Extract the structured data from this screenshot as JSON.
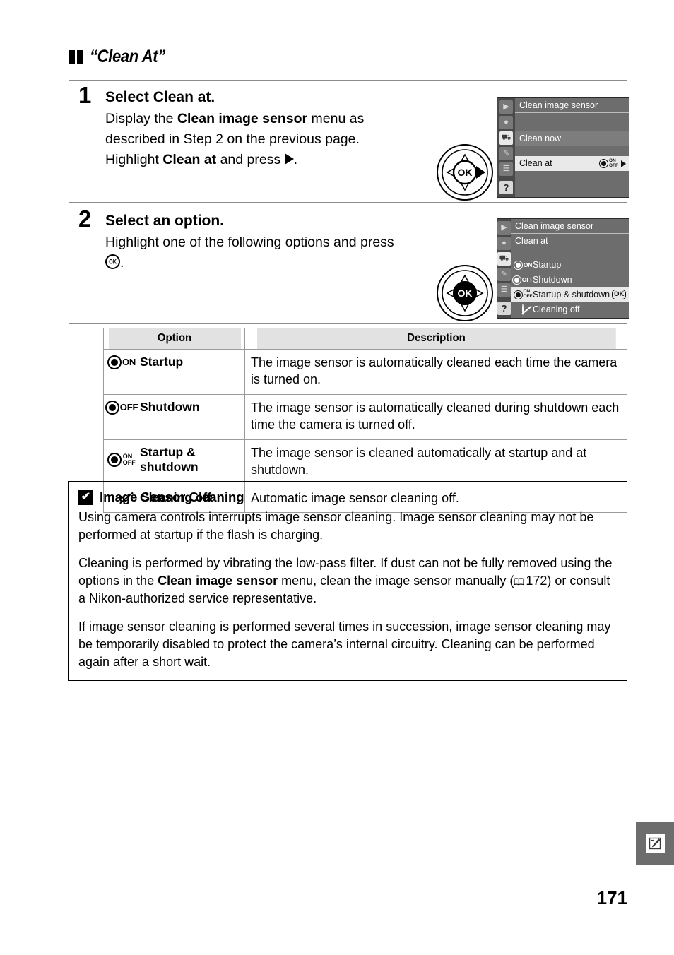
{
  "section": {
    "title": "“Clean At”"
  },
  "steps": [
    {
      "number": "1",
      "title_prefix": "Select ",
      "title_bold": "Clean at",
      "title_suffix": ".",
      "line1_a": "Display the ",
      "line1_b": "Clean image sensor",
      "line1_c": " menu as",
      "line2": "described in Step 2 on the previous page.",
      "line3_a": "Highlight ",
      "line3_b": "Clean at",
      "line3_c": " and press ",
      "line3_d": "."
    },
    {
      "number": "2",
      "title": "Select an option.",
      "line1": "Highlight one of the following options and press",
      "line2_suffix": "."
    }
  ],
  "lcd_screens": [
    {
      "title": "Clean image sensor",
      "rows": [
        {
          "label": "Clean now",
          "style": "band"
        },
        {
          "label": "Clean at",
          "style": "highlight",
          "icon": "sensor-on-off",
          "arrow": true
        }
      ],
      "rail_icons": [
        "playback-icon",
        "shooting-menu-icon",
        "setup-menu-icon",
        "custom-settings-icon",
        "recent-settings-icon"
      ],
      "help_label": "?"
    },
    {
      "title": "Clean image sensor",
      "subtitle": "Clean at",
      "options": [
        {
          "label": "Startup",
          "icon": "sensor-on",
          "style": "normal"
        },
        {
          "label": "Shutdown",
          "icon": "sensor-off",
          "style": "normal"
        },
        {
          "label": "Startup & shutdown",
          "icon": "sensor-on-off",
          "style": "highlight",
          "badge": "OK"
        },
        {
          "label": "Cleaning off",
          "icon": "cleaning-off",
          "style": "normal"
        }
      ],
      "rail_icons": [
        "playback-icon",
        "shooting-menu-icon",
        "setup-menu-icon",
        "custom-settings-icon",
        "recent-settings-icon"
      ],
      "help_label": "?"
    }
  ],
  "dials": [
    {
      "highlight": "right-arrow"
    },
    {
      "highlight": "ok-center"
    }
  ],
  "table": {
    "headers": {
      "option": "Option",
      "description": "Description"
    },
    "rows": [
      {
        "icon": "sensor-on",
        "option": "Startup",
        "description": "The image sensor is automatically cleaned each time the camera is turned on."
      },
      {
        "icon": "sensor-off",
        "option": "Shutdown",
        "description": "The image sensor is automatically cleaned during shutdown each time the camera is turned off."
      },
      {
        "icon": "sensor-on-off",
        "option": "Startup & shutdown",
        "description": "The image sensor is cleaned automatically at startup and at shutdown."
      },
      {
        "icon": "cleaning-off",
        "option": "Cleaning off",
        "description": "Automatic image sensor cleaning off."
      }
    ]
  },
  "note": {
    "mark": "✔",
    "title": "Image Sensor Cleaning",
    "p1": "Using camera controls interrupts image sensor cleaning.  Image sensor cleaning may not be performed at startup if the flash is charging.",
    "p2_a": "Cleaning is performed by vibrating the low-pass filter.  If dust can not be fully removed using the options in the ",
    "p2_b": "Clean image sensor",
    "p2_c": " menu, clean the image sensor manually (",
    "p2_ref": "172",
    "p2_d": ") or consult a Nikon-authorized service representative.",
    "p3": "If image sensor cleaning is performed several times in succession, image sensor cleaning may be temporarily disabled to protect the camera’s internal circuitry.  Cleaning can be performed again after a short wait."
  },
  "footer": {
    "page_number": "171",
    "thumb_tab_icon": "pencil-note-icon"
  }
}
